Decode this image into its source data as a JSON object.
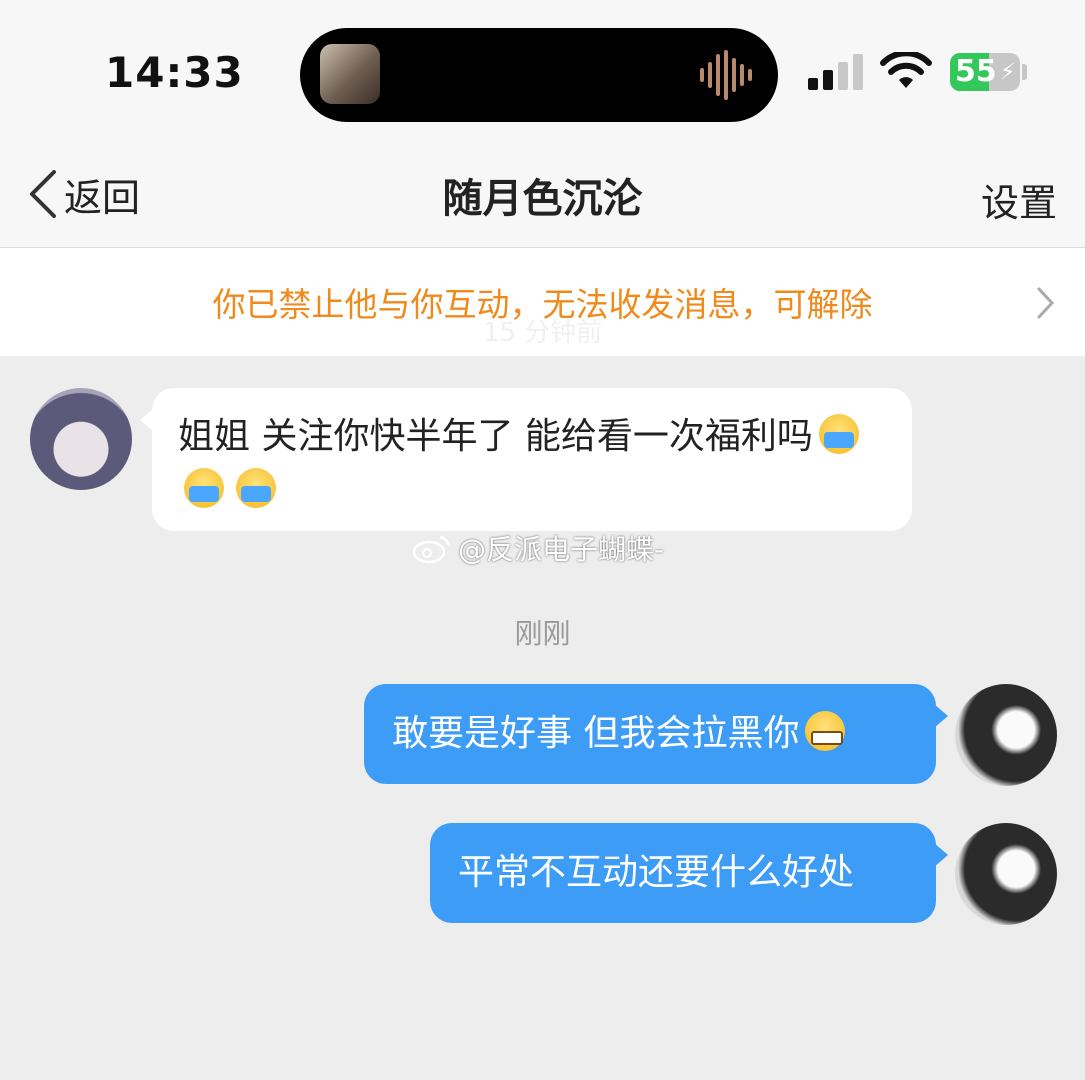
{
  "status_bar": {
    "time": "14:33",
    "battery_level": "55",
    "icons": [
      "music-thumbnail-icon",
      "audio-waveform-icon",
      "signal-icon",
      "wifi-icon",
      "battery-icon"
    ]
  },
  "nav": {
    "back_label": "返回",
    "title": "随月色沉沦",
    "settings_label": "设置"
  },
  "banner": {
    "text": "你已禁止他与你互动，无法收发消息，可解除",
    "obscured_time": "15 分钟前"
  },
  "messages": [
    {
      "direction": "incoming",
      "text": "姐姐 关注你快半年了 能给看一次福利吗",
      "emojis": [
        "crying-emoji",
        "crying-emoji",
        "crying-emoji"
      ]
    },
    {
      "direction": "outgoing",
      "text": "敢要是好事 但我会拉黑你",
      "emojis": [
        "grinning-emoji"
      ]
    },
    {
      "direction": "outgoing",
      "text": "平常不互动还要什么好处",
      "emojis": []
    }
  ],
  "timestamp": "刚刚",
  "watermark": "@反派电子蝴蝶-",
  "colors": {
    "outgoing_bubble": "#3d9cf6",
    "banner_text": "#f08a1c",
    "background": "#ededed",
    "battery": "#34c759"
  }
}
